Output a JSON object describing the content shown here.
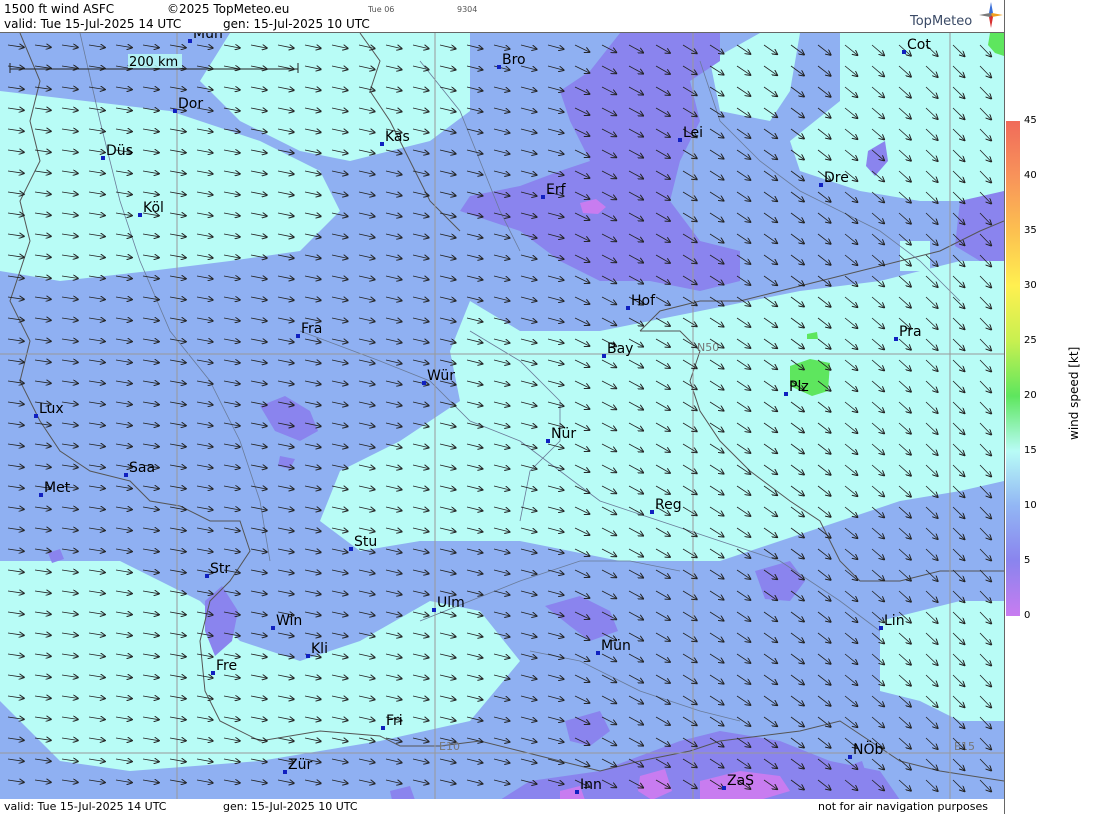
{
  "header": {
    "product": "1500 ft wind ASFC",
    "copyright": "©2025 TopMeteo.eu",
    "small1": "Tue 06",
    "small2": "9304",
    "valid": "valid:  Tue  15-Jul-2025  14 UTC",
    "gen": "gen: 15-Jul-2025 10 UTC",
    "logo": "TopMeteo"
  },
  "footer": {
    "valid": "valid:  Tue  15-Jul-2025  14 UTC",
    "gen": "gen: 15-Jul-2025 10 UTC",
    "disclaimer": "not for air navigation purposes"
  },
  "map": {
    "scale_label": "200 km",
    "grid_labels": [
      "N50",
      "E10",
      "E15"
    ],
    "cities": [
      {
        "name": "Mün",
        "id": "mun-top"
      },
      {
        "name": "Bro"
      },
      {
        "name": "Cot"
      },
      {
        "name": "Dor"
      },
      {
        "name": "Kas"
      },
      {
        "name": "Lei"
      },
      {
        "name": "Düs"
      },
      {
        "name": "Dre"
      },
      {
        "name": "Köl"
      },
      {
        "name": "Erf"
      },
      {
        "name": "Hof"
      },
      {
        "name": "Fra"
      },
      {
        "name": "Pra"
      },
      {
        "name": "Bay"
      },
      {
        "name": "Wür"
      },
      {
        "name": "Plz"
      },
      {
        "name": "Lux"
      },
      {
        "name": "Nür"
      },
      {
        "name": "Saa"
      },
      {
        "name": "Met"
      },
      {
        "name": "Reg"
      },
      {
        "name": "Stu"
      },
      {
        "name": "Str"
      },
      {
        "name": "Ulm"
      },
      {
        "name": "Win"
      },
      {
        "name": "Lin"
      },
      {
        "name": "Kli"
      },
      {
        "name": "Mün"
      },
      {
        "name": "Fre"
      },
      {
        "name": "Fri"
      },
      {
        "name": "NÖb"
      },
      {
        "name": "Zür"
      },
      {
        "name": "ZaS"
      },
      {
        "name": "Inn"
      }
    ]
  },
  "legend": {
    "title": "wind speed [kt]",
    "ticks": [
      "45",
      "40",
      "35",
      "30",
      "25",
      "20",
      "15",
      "10",
      "5",
      "0"
    ],
    "colors": [
      "#f06b5a",
      "#f8935a",
      "#fcc050",
      "#fff050",
      "#c8f050",
      "#5ee65e",
      "#b8fcf6",
      "#92b6f4",
      "#8a84ee",
      "#c87cf0"
    ]
  }
}
